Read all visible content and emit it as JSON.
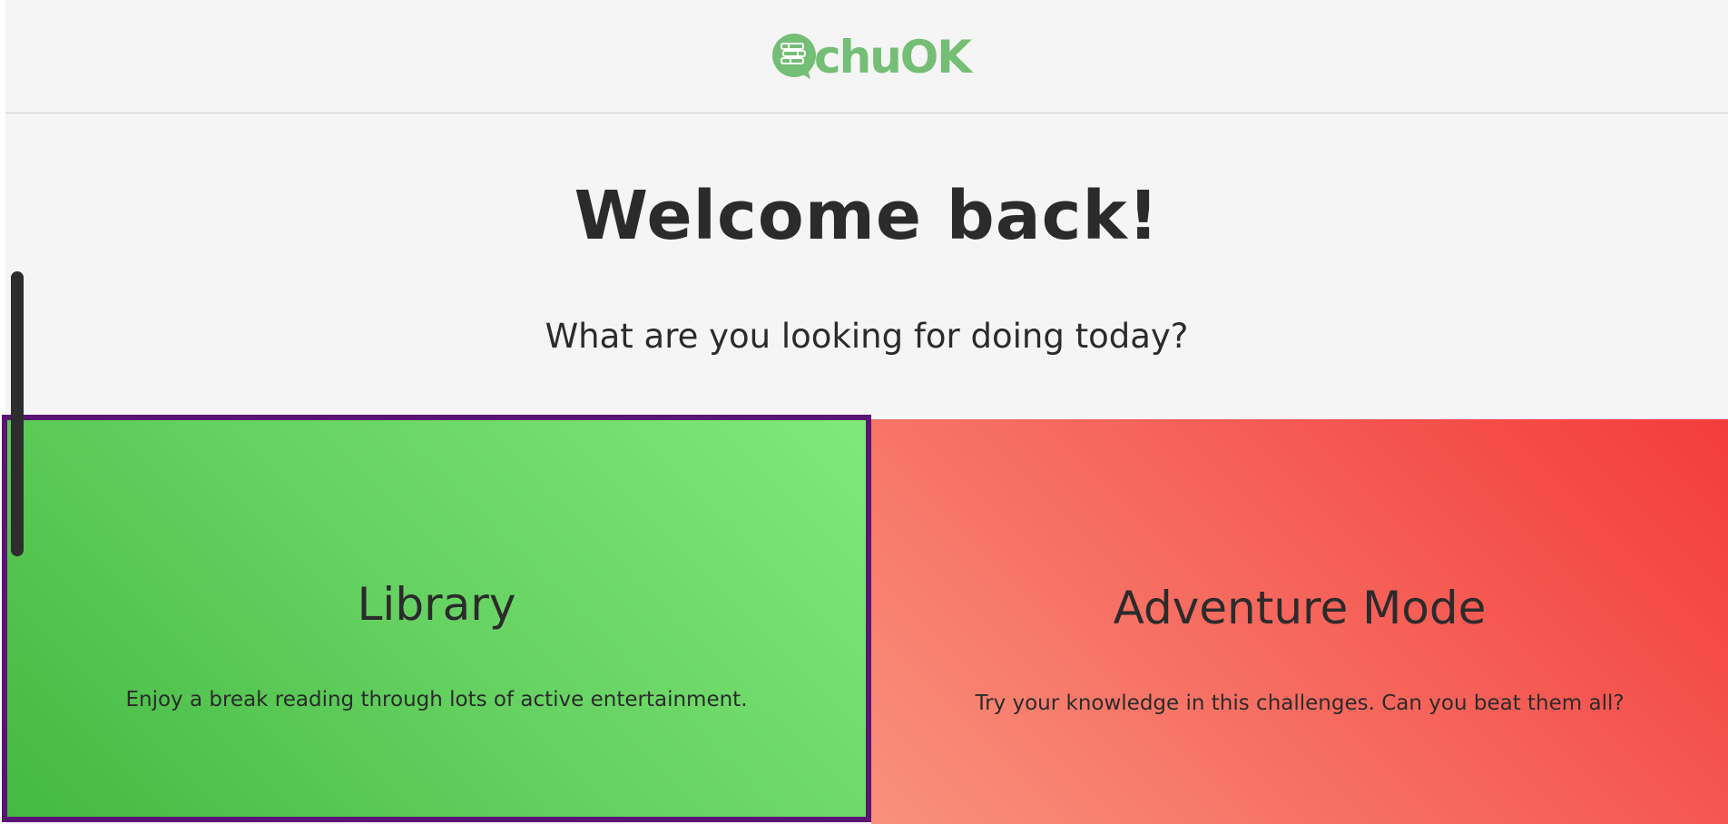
{
  "brand": {
    "logo_text": "chuOK",
    "logo_icon": "book-chat-icon",
    "color": "#74be75"
  },
  "hero": {
    "title": "Welcome back!",
    "subtitle": "What are you looking for doing today?"
  },
  "cards": {
    "library": {
      "title": "Library",
      "description": "Enjoy a break reading through lots of active entertainment.",
      "gradient_start": "#45b941",
      "gradient_end": "#7fe979",
      "border_color": "#5a1474"
    },
    "adventure": {
      "title": "Adventure Mode",
      "description": "Try your knowledge in this challenges. Can you beat them all?",
      "gradient_start": "#f9917c",
      "gradient_end": "#f33c3b"
    }
  }
}
